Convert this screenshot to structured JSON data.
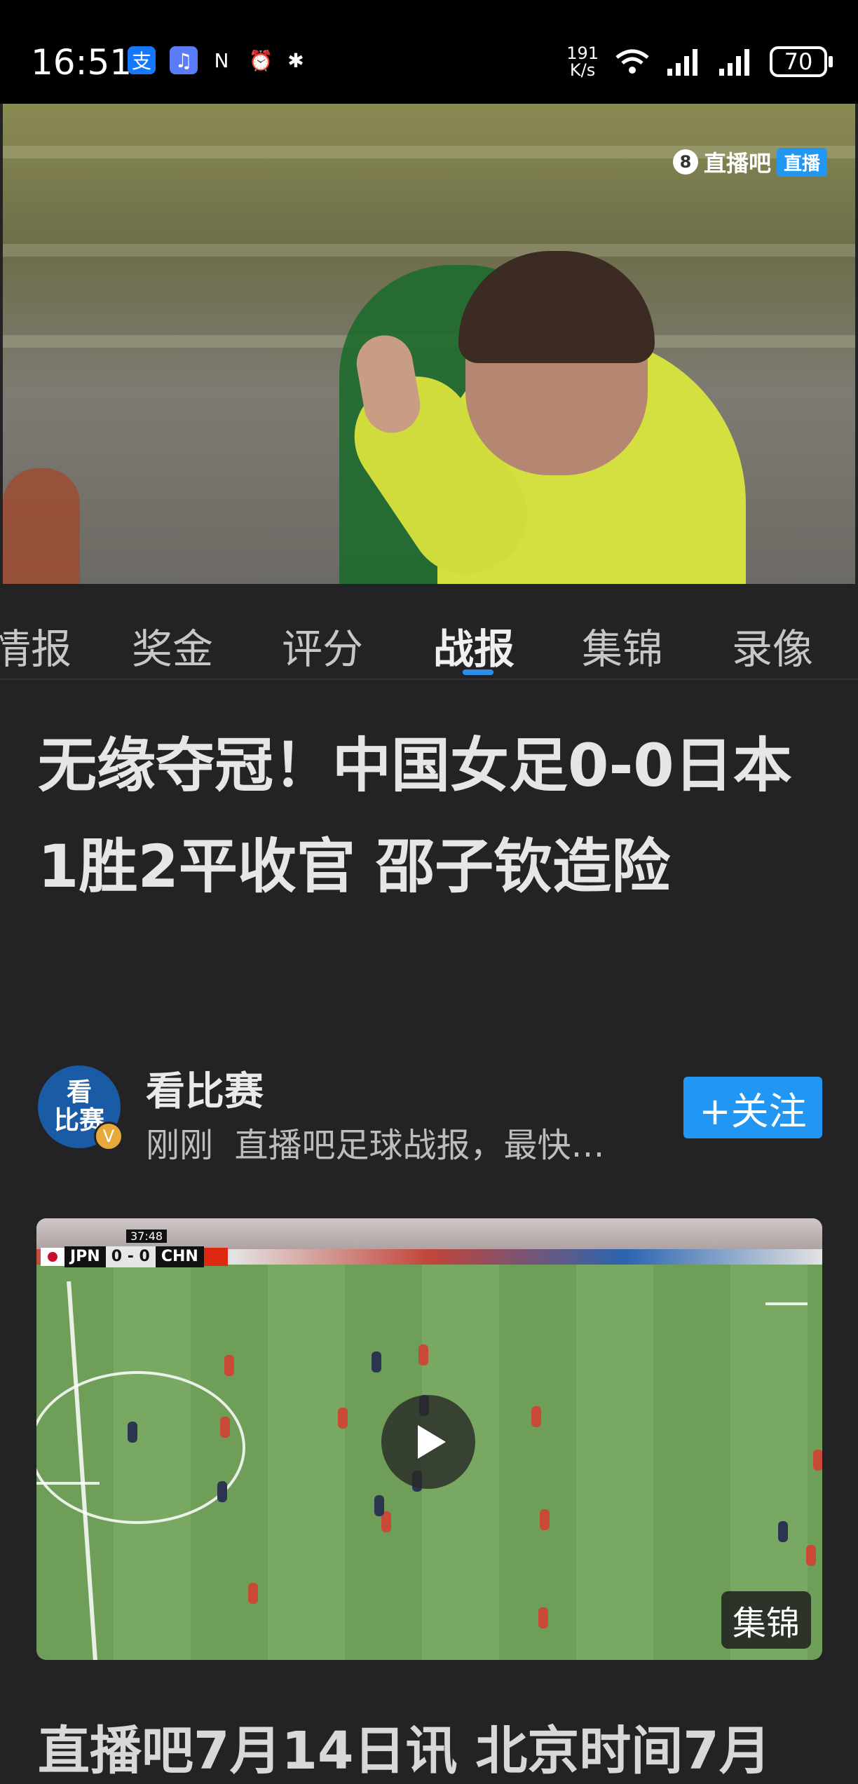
{
  "status_bar": {
    "time": "16:51",
    "net_speed_value": "191",
    "net_speed_unit": "K/s",
    "battery": "70",
    "icons": [
      "alipay-icon",
      "music-icon",
      "nfc-icon",
      "alarm-icon",
      "bluetooth-icon",
      "wifi-icon",
      "signal-icon",
      "signal-icon",
      "battery-icon"
    ]
  },
  "video": {
    "logo_text": "直播吧",
    "logo_badge": "直播"
  },
  "tabs": [
    {
      "label": "情报",
      "active": false
    },
    {
      "label": "奖金",
      "active": false
    },
    {
      "label": "评分",
      "active": false
    },
    {
      "label": "战报",
      "active": true
    },
    {
      "label": "集锦",
      "active": false
    },
    {
      "label": "录像",
      "active": false
    }
  ],
  "article": {
    "headline": "无缘夺冠！中国女足0-0日本1胜2平收官 邵子钦造险"
  },
  "author": {
    "name": "看比赛",
    "avatar_text_top": "看",
    "avatar_text_bottom": "比赛",
    "time": "刚刚",
    "description": "直播吧足球战报，最快…",
    "follow_label": "+关注"
  },
  "highlight": {
    "clock": "37:48",
    "home": "JPN",
    "score": "0 - 0",
    "away": "CHN",
    "label": "集锦"
  },
  "next_line": "直播吧7月14日讯 北京时间7月"
}
